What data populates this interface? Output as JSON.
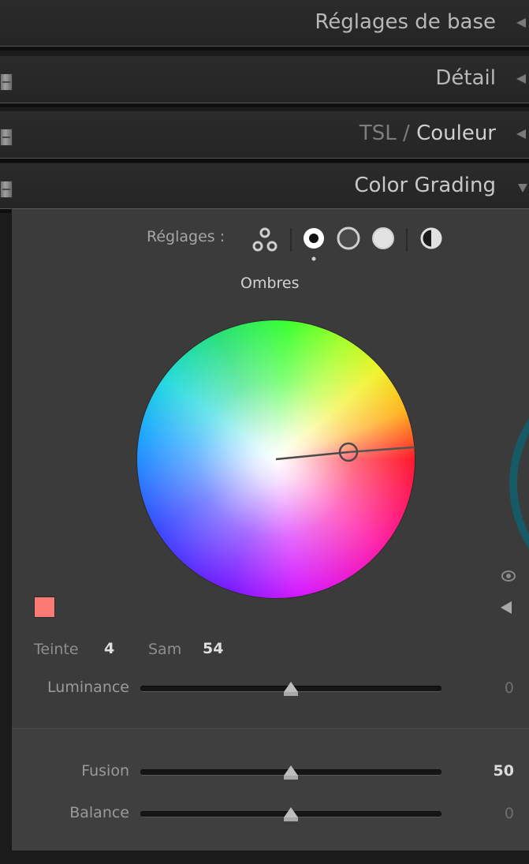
{
  "sections": {
    "basic": "Réglages de base",
    "detail": "Détail",
    "hsl_part": "TSL",
    "hsl_sep": " / ",
    "color_part": "Couleur",
    "color_grading": "Color Grading"
  },
  "color_grading": {
    "adjust_label": "Réglages :",
    "region_label": "Ombres",
    "hue_label": "Teinte",
    "hue_value": "4",
    "sat_label": "Sam",
    "sat_value": "54",
    "swatch_color": "#f87a72",
    "luminance": {
      "label": "Luminance",
      "value": "0",
      "level": 0.5
    },
    "blending": {
      "label": "Fusion",
      "value": "50",
      "level": 0.5
    },
    "balance": {
      "label": "Balance",
      "value": "0",
      "level": 0.5
    }
  },
  "icons": [
    "three-way-icon",
    "shadows-icon",
    "midtones-icon",
    "highlights-icon",
    "global-icon",
    "eye-icon",
    "back-arrow-icon"
  ]
}
